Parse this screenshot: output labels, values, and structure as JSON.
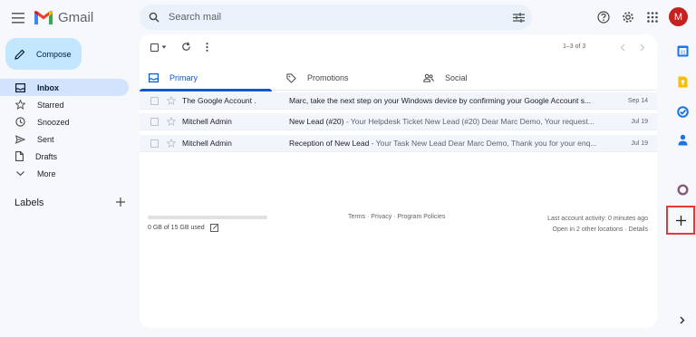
{
  "header": {
    "app_name": "Gmail",
    "search_placeholder": "Search mail",
    "avatar_letter": "M"
  },
  "sidebar": {
    "compose_label": "Compose",
    "items": [
      {
        "label": "Inbox",
        "icon": "inbox-icon",
        "active": true
      },
      {
        "label": "Starred",
        "icon": "star-icon"
      },
      {
        "label": "Snoozed",
        "icon": "clock-icon"
      },
      {
        "label": "Sent",
        "icon": "send-icon"
      },
      {
        "label": "Drafts",
        "icon": "draft-icon"
      },
      {
        "label": "More",
        "icon": "chevron-down-icon"
      }
    ],
    "labels_title": "Labels"
  },
  "toolbar": {
    "pager": "1–3 of 3"
  },
  "tabs": [
    {
      "label": "Primary",
      "icon": "inbox-icon",
      "active": true
    },
    {
      "label": "Promotions",
      "icon": "tag-icon"
    },
    {
      "label": "Social",
      "icon": "people-icon"
    }
  ],
  "emails": [
    {
      "sender": "The Google Account .",
      "subject": "Marc, take the next step on your Windows device by confirming your Google Account s...",
      "snippet": "",
      "date": "Sep 14"
    },
    {
      "sender": "Mitchell Admin",
      "subject": "New Lead (#20)",
      "snippet": " - Your Helpdesk Ticket New Lead (#20) Dear Marc Demo, Your request...",
      "date": "Jul 19"
    },
    {
      "sender": "Mitchell Admin",
      "subject": "Reception of New Lead",
      "snippet": " - Your Task New Lead Dear Marc Demo, Thank you for your enq...",
      "date": "Jul 19"
    }
  ],
  "footer": {
    "storage_text": "0 GB of 15 GB used",
    "storage_fraction": 0.0,
    "links": "Terms · Privacy · Program Policies",
    "activity_line1": "Last account activity: 0 minutes ago",
    "activity_line2": "Open in 2 other locations · Details"
  },
  "colors": {
    "accent": "#0b57d0",
    "compose_bg": "#c2e7ff",
    "active_nav": "#d3e3fd",
    "avatar_bg": "#c5221f",
    "highlight_border": "#e53935"
  }
}
